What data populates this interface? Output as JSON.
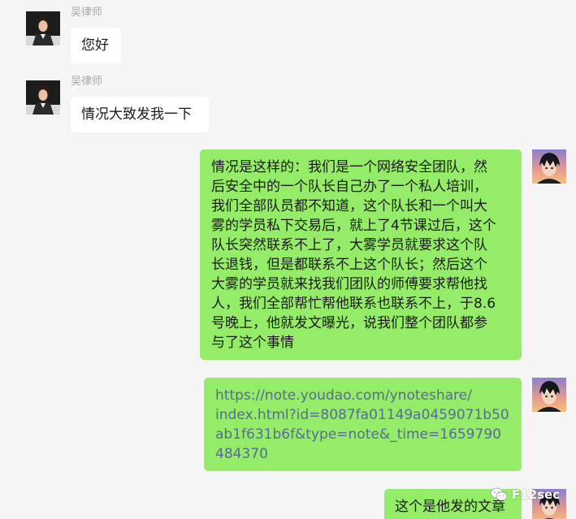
{
  "colors": {
    "background": "#f5f5f5",
    "incoming_bubble": "#ffffff",
    "outgoing_bubble": "#95ec69",
    "link_text": "#576b95",
    "sender_name": "#a8a8a8"
  },
  "messages": [
    {
      "sender": "吴律师",
      "direction": "incoming",
      "avatar": "lawyer-avatar",
      "lines": [
        "您好"
      ]
    },
    {
      "sender": "吴律师",
      "direction": "incoming",
      "avatar": "lawyer-avatar",
      "lines": [
        "情况大致发我一下"
      ]
    },
    {
      "direction": "outgoing",
      "avatar": "anime-avatar",
      "lines": [
        "情况是这样的：我们是一个网络安全团队，然",
        "后安全中的一个队长自己办了一个私人培训，",
        "我们全部队员都不知道，这个队长和一个叫大",
        "雾的学员私下交易后，就上了4节课过后，这个",
        "队长突然联系不上了，大雾学员就要求这个队",
        "长退钱，但是都联系不上这个队长；然后这个",
        "大雾的学员就来找我们团队的师傅要求帮他找",
        "人，我们全部帮忙帮他联系也联系不上，于8.6",
        "号晚上，他就发文曝光，说我们整个团队都参",
        "与了这个事情"
      ]
    },
    {
      "direction": "outgoing",
      "avatar": "anime-avatar",
      "type": "link",
      "lines": [
        "https://note.youdao.com/ynoteshare/",
        "index.html?id=8087fa01149a0459071b50",
        "ab1f631b6f&type=note&_time=1659790",
        "484370"
      ]
    },
    {
      "direction": "outgoing",
      "avatar": "anime-avatar",
      "lines": [
        "这个是他发的文章"
      ]
    }
  ],
  "watermark": {
    "icon": "wechat-icon",
    "text": "F12sec"
  }
}
